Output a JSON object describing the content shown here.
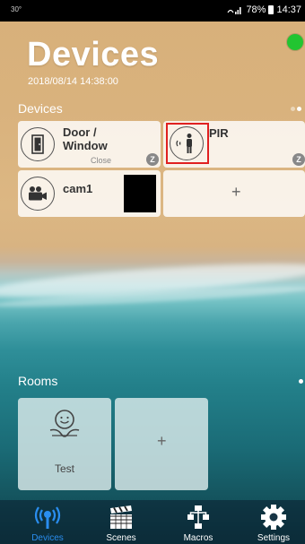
{
  "statusbar": {
    "left": "30°",
    "battery": "78%",
    "time": "14:37"
  },
  "header": {
    "title": "Devices",
    "datetime": "2018/08/14 14:38:00"
  },
  "devices_section": {
    "label": "Devices",
    "tiles": [
      {
        "name": "Door /\nWindow",
        "line1": "Door /",
        "line2": "Window",
        "state": "Close",
        "badge": "Z"
      },
      {
        "name": "PIR",
        "badge": "Z"
      },
      {
        "name": "cam1"
      },
      {
        "add": "+"
      }
    ]
  },
  "rooms_section": {
    "label": "Rooms",
    "tiles": [
      {
        "name": "Test"
      },
      {
        "add": "+"
      }
    ]
  },
  "nav": {
    "items": [
      {
        "label": "Devices",
        "icon": "devices-icon",
        "active": true
      },
      {
        "label": "Scenes",
        "icon": "scenes-icon",
        "active": false
      },
      {
        "label": "Macros",
        "icon": "macros-icon",
        "active": false
      },
      {
        "label": "Settings",
        "icon": "settings-icon",
        "active": false
      }
    ]
  },
  "colors": {
    "online": "#22c531",
    "active_nav": "#2a8ef0",
    "highlight": "#e02020"
  }
}
